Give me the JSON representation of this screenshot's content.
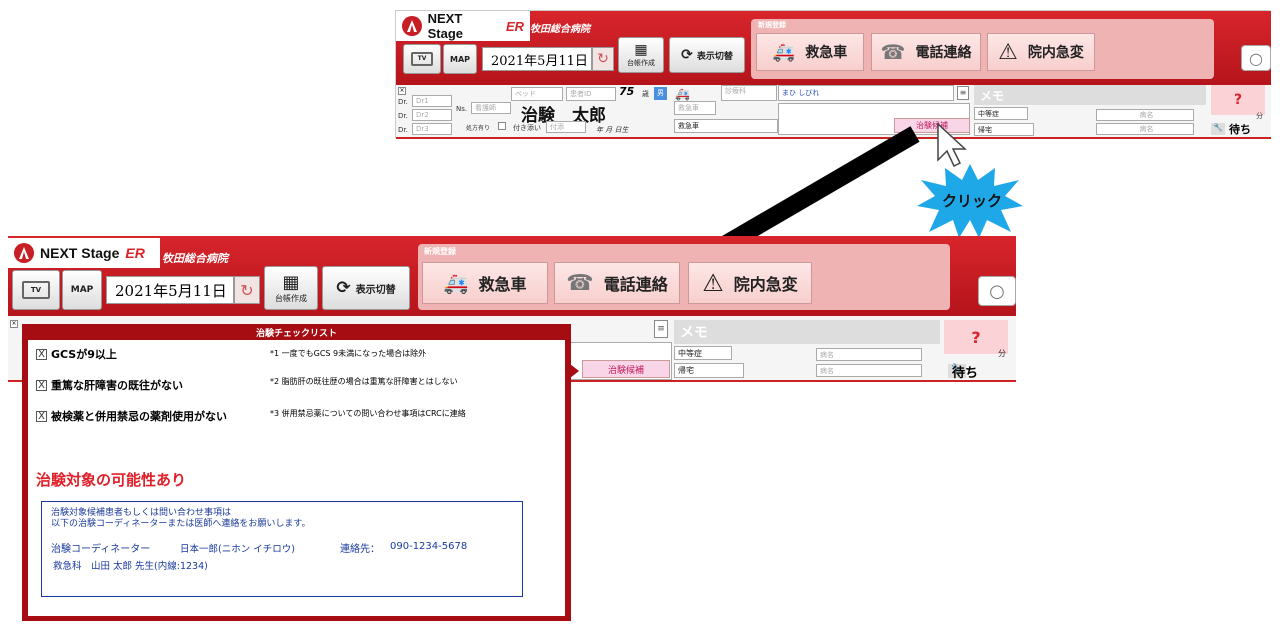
{
  "app": {
    "logo_text": "NEXT Stage",
    "logo_er": "ER",
    "hospital": "牧田総合病院"
  },
  "toolbar": {
    "tv": "TV",
    "map": "MAP",
    "date": "2021年5月11日",
    "ledger": "台帳作成",
    "toggle": "表示切替"
  },
  "new_entry": {
    "title": "新規登録",
    "ambulance": "救急車",
    "phone": "電話連絡",
    "inhospital": "院内急変"
  },
  "patient": {
    "doctor_prefix": "Dr.",
    "dr1": "Dr1",
    "dr2": "Dr2",
    "dr3": "Dr3",
    "ns_label": "Ns.",
    "ns_placeholder": "看護師",
    "bed_placeholder": "ベッド",
    "pid_placeholder": "患者ID",
    "name": "治験　太郎",
    "age": "75",
    "age_unit": "歳",
    "sex": "男",
    "ambulance_placeholder": "救急車",
    "dept_placeholder": "診療科",
    "prescription": "処方有り",
    "attendant": "付き添い",
    "attendant_placeholder": "付添",
    "birth": "年 月 日生",
    "transport": "救急車",
    "symptom": "まひ しびれ",
    "trial_button": "治験候補",
    "memo": "メモ",
    "severity": "中等症",
    "outcome": "帰宅",
    "diag_placeholder": "病名",
    "question": "?",
    "minutes_unit": "分",
    "waiting": "待ち"
  },
  "annotation": {
    "click": "クリック"
  },
  "modal": {
    "title": "治験チェックリスト",
    "items": [
      {
        "check": "X",
        "label": "GCSが9以上",
        "note": "*1 一度でもGCS 9未満になった場合は除外"
      },
      {
        "check": "X",
        "label": "重篤な肝障害の既往がない",
        "note": "*2 脂肪肝の既往歴の場合は重篤な肝障害とはしない"
      },
      {
        "check": "X",
        "label": "被検薬と併用禁忌の薬剤使用がない",
        "note": "*3 併用禁忌薬についての問い合わせ事項はCRCに連絡"
      }
    ],
    "result": "治験対象の可能性あり",
    "contact_line1": "治験対象候補患者もしくは問い合わせ事項は",
    "contact_line2": "以下の治験コーディネーターまたは医師へ連絡をお願いします。",
    "coordinator_label": "治験コーディネーター",
    "coordinator_name": "日本一郎(ニホン イチロウ)",
    "contact_label": "連絡先：",
    "contact_phone": "090-1234-5678",
    "doctor_line": "救急科　山田 太郎 先生(内線:1234)"
  },
  "colors": {
    "brand_red": "#c81e25",
    "pink_panel": "#f0b3b3",
    "modal_border": "#a60d12",
    "result_red": "#e0202a",
    "contact_blue": "#1a3a9c"
  }
}
